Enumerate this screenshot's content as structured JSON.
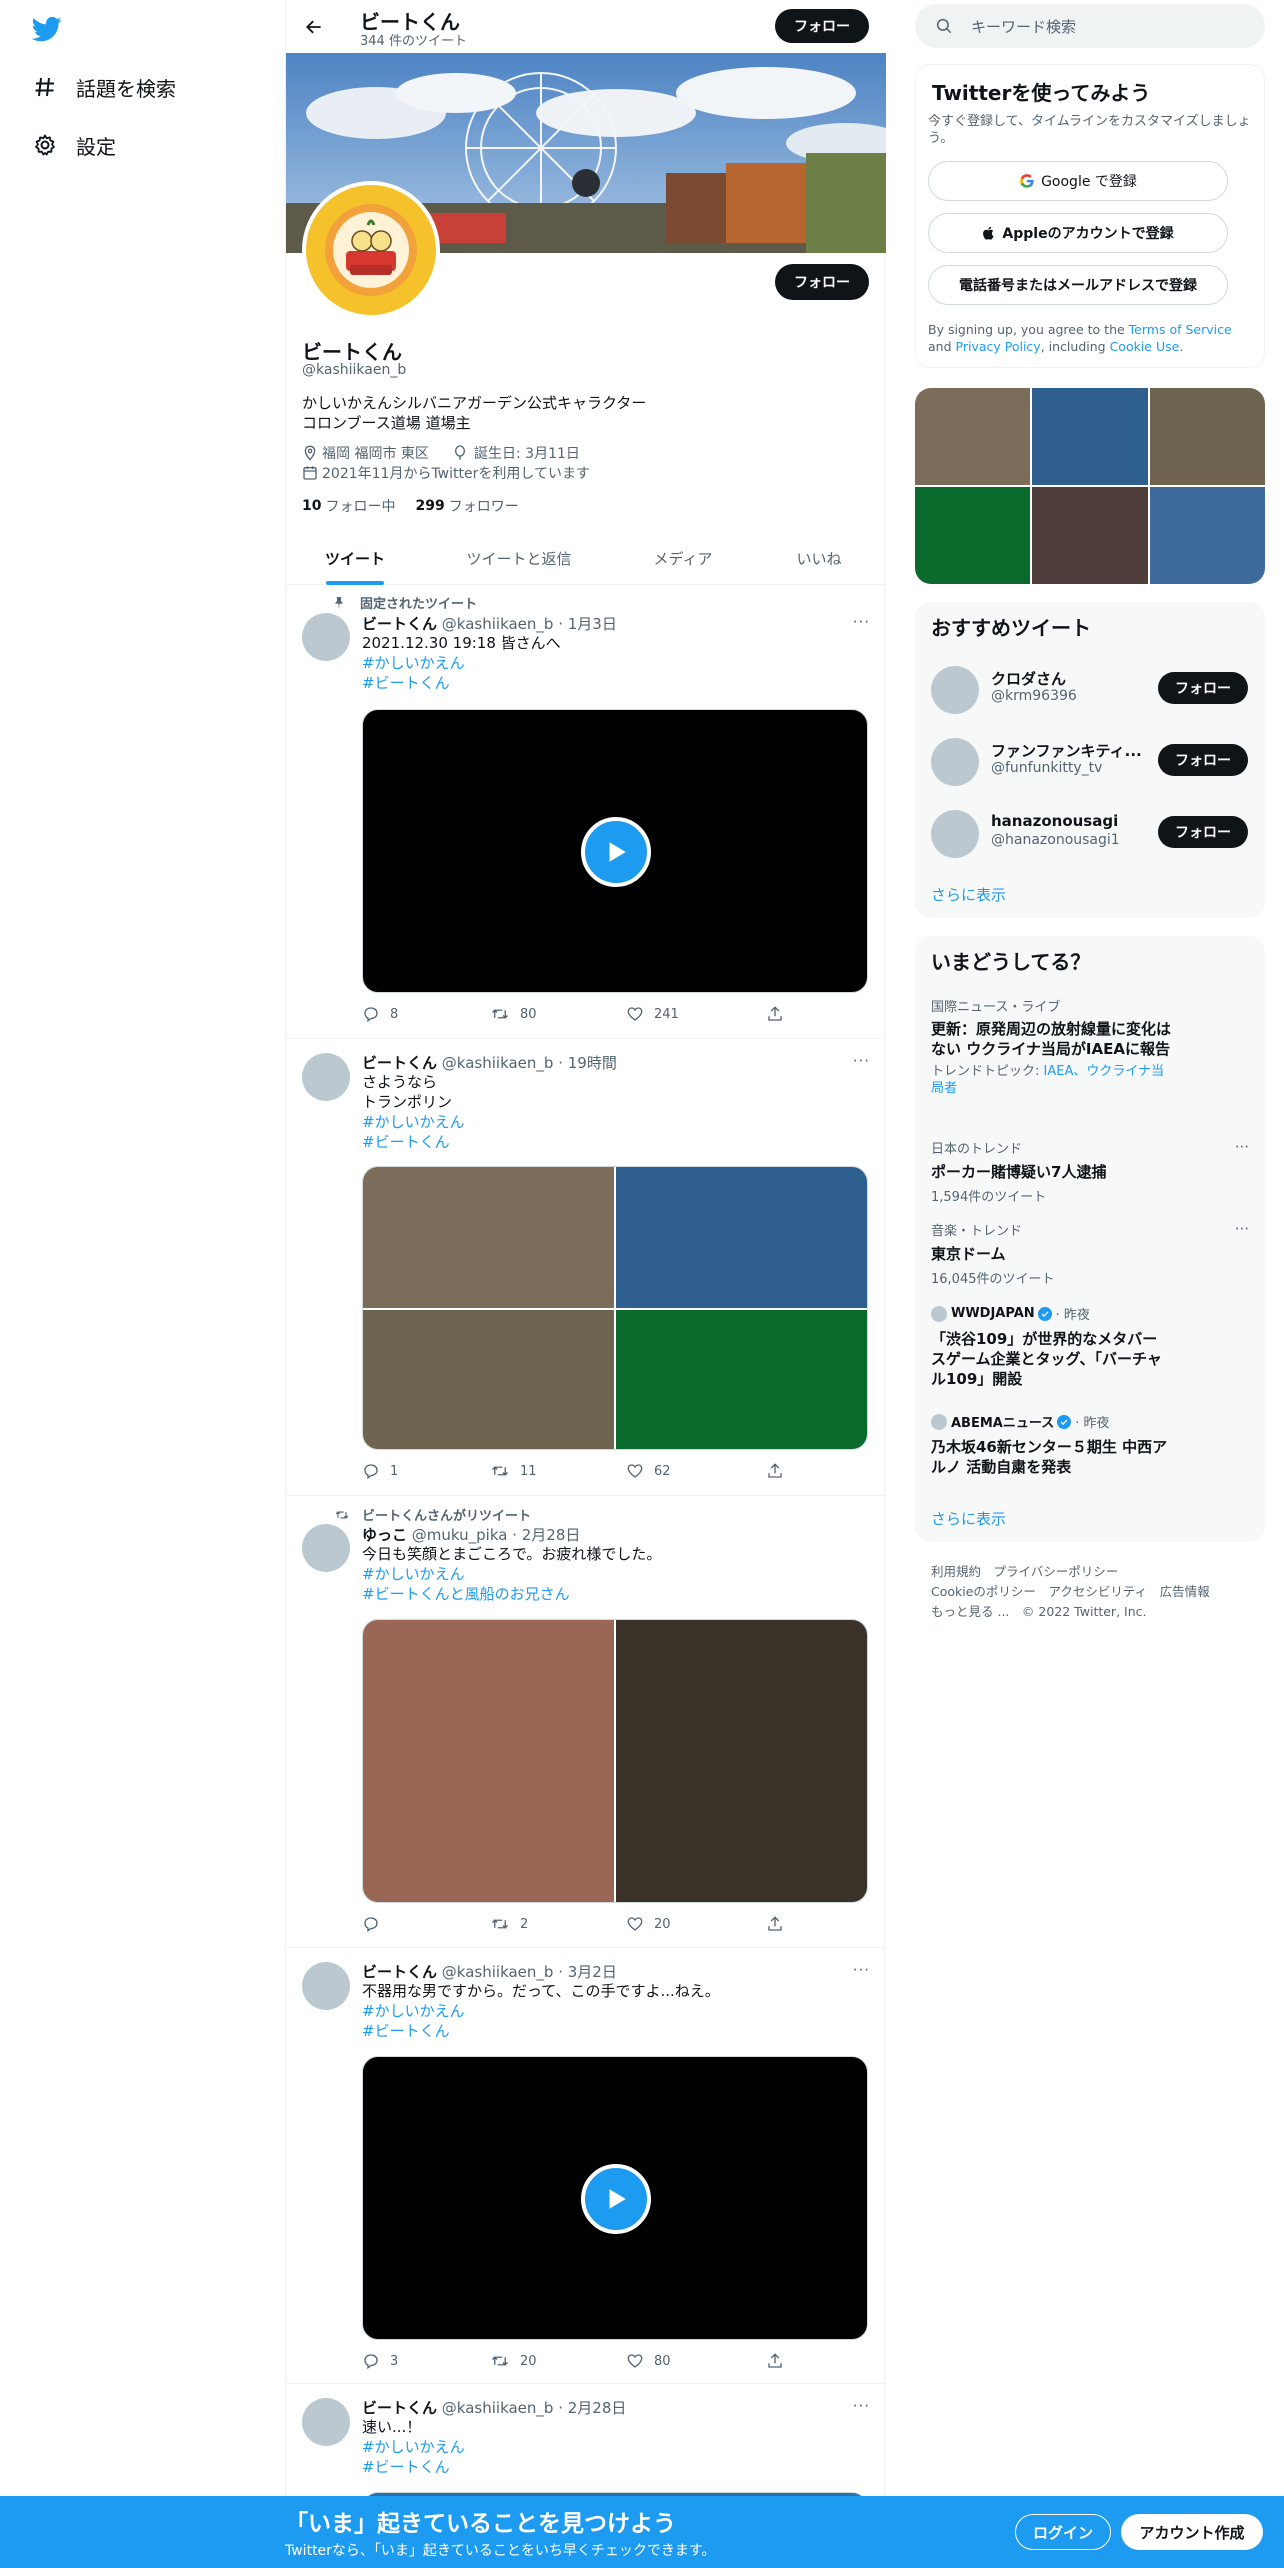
{
  "nav": {
    "explore": "話題を検索",
    "settings": "設定"
  },
  "header": {
    "name": "ビートくん",
    "tweet_count": "344 件のツイート",
    "follow": "フォロー"
  },
  "profile": {
    "name": "ビートくん",
    "handle": "@kashiikaen_b",
    "bio_line1": "かしいかえんシルバニアガーデン公式キャラクター",
    "bio_line2": "コロンブース道場 道場主",
    "location": "福岡 福岡市 東区",
    "birthday": "誕生日: 3月11日",
    "joined": "2021年11月からTwitterを利用しています",
    "following_count": "10",
    "following_label": "フォロー中",
    "followers_count": "299",
    "followers_label": "フォロワー",
    "follow": "フォロー"
  },
  "tabs": [
    "ツイート",
    "ツイートと返信",
    "メディア",
    "いいね"
  ],
  "tweets": [
    {
      "context": "固定されたツイート",
      "name": "ビートくん",
      "meta": "@kashiikaen_b · 1月3日",
      "lines": [
        "2021.12.30 19:18 皆さんへ"
      ],
      "tags": [
        "#かしいかえん",
        "#ビートくん"
      ],
      "reply": "8",
      "retweet": "80",
      "like": "241"
    },
    {
      "context": "",
      "name": "ビートくん",
      "meta": "@kashiikaen_b · 19時間",
      "lines": [
        "さようなら",
        "トランポリン"
      ],
      "tags": [
        "#かしいかえん",
        "#ビートくん"
      ],
      "reply": "1",
      "retweet": "11",
      "like": "62"
    },
    {
      "context": "ビートくんさんがリツイート",
      "name": "ゆっこ",
      "meta": "@muku_pika · 2月28日",
      "lines": [
        "今日も笑顔とまごころで。お疲れ様でした。"
      ],
      "tags": [
        "#かしいかえん",
        "#ビートくんと風船のお兄さん"
      ],
      "reply": "",
      "retweet": "2",
      "like": "20"
    },
    {
      "context": "",
      "name": "ビートくん",
      "meta": "@kashiikaen_b · 3月2日",
      "lines": [
        "不器用な男ですから。だって、この手ですよ...ねえ。"
      ],
      "tags": [
        "#かしいかえん",
        "#ビートくん"
      ],
      "reply": "3",
      "retweet": "20",
      "like": "80"
    },
    {
      "context": "",
      "name": "ビートくん",
      "meta": "@kashiikaen_b · 2月28日",
      "lines": [
        "速い...！"
      ],
      "tags": [
        "#かしいかえん",
        "#ビートくん"
      ],
      "reply": "",
      "retweet": "",
      "like": ""
    }
  ],
  "search": {
    "placeholder": "キーワード検索"
  },
  "signup": {
    "title": "Twitterを使ってみよう",
    "desc": "今すぐ登録して、タイムラインをカスタマイズしましょう。",
    "google": "Google で登録",
    "apple": "Appleのアカウントで登録",
    "phone": "電話番号またはメールアドレスで登録",
    "terms_pre": "By signing up, you agree to the",
    "terms_link": "Terms of Service",
    "terms_and": "and",
    "privacy_link": "Privacy Policy",
    "terms_mid": ", including",
    "cookie_link": "Cookie Use",
    "terms_end": "."
  },
  "photo_colors": [
    "#7c6d5a",
    "#2e5f8e",
    "#6f6450",
    "#0a6a2c",
    "#4e3d3b",
    "#3f6b9c"
  ],
  "tweet2_colors": [
    "#7c6d5a",
    "#2e5f8e",
    "#6f6450",
    "#0a6a2c"
  ],
  "tweet3_colors": [
    "#9a6656",
    "#3a3129"
  ],
  "recommend": {
    "title": "おすすめツイート",
    "users": [
      {
        "name": "クロダさん",
        "handle": "@krm96396",
        "follow": "フォロー"
      },
      {
        "name": "ファンファンキティ...",
        "handle": "@funfunkitty_tv",
        "follow": "フォロー"
      },
      {
        "name": "hanazonousagi",
        "handle": "@hanazonousagi1",
        "follow": "フォロー"
      }
    ],
    "more": "さらに表示"
  },
  "trends": {
    "title": "いまどうしてる？",
    "items": [
      {
        "category": "国際ニュース・ライブ",
        "headline": "更新：原発周辺の放射線量に変化はない ウクライナ当局がIAEAに報告",
        "topic_label": "トレンドトピック:",
        "topic_links": "IAEA、ウクライナ当局者"
      },
      {
        "category": "日本のトレンド",
        "headline": "ポーカー賭博疑い7人逮捕",
        "count": "1,594件のツイート"
      },
      {
        "category": "音楽・トレンド",
        "headline": "東京ドーム",
        "count": "16,045件のツイート"
      },
      {
        "source": "WWDJAPAN",
        "time": "· 昨夜",
        "headline": "「渋谷109」が世界的なメタバースゲーム企業とタッグ、「バーチャル109」開設"
      },
      {
        "source": "ABEMAニュース",
        "time": "· 昨夜",
        "headline": "乃木坂46新センター５期生 中西アルノ 活動自粛を発表"
      }
    ],
    "more": "さらに表示"
  },
  "footer": {
    "line1": [
      "利用規約",
      "プライバシーポリシー"
    ],
    "line2": [
      "Cookieのポリシー",
      "アクセシビリティ",
      "広告情報"
    ],
    "more": "もっと見る ...",
    "copyright": "© 2022 Twitter, Inc."
  },
  "bottom_bar": {
    "title": "「いま」起きていることを見つけよう",
    "subtitle": "Twitterなら、「いま」起きていることをいち早くチェックできます。",
    "login": "ログイン",
    "signup": "アカウント作成"
  },
  "colors": {
    "accent": "#1d9bf0",
    "bar": "#1d9bf0",
    "avatar_ring": "#f6c22b"
  }
}
